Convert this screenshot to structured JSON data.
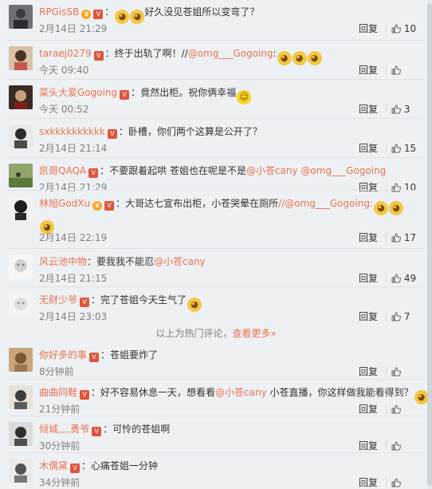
{
  "hot_comments": [
    {
      "user": "RPGisSB",
      "crown": true,
      "mentions": [],
      "text": "好久没见苍姐所以变弯了？",
      "lead_emoji": 2,
      "trail_emoji": 0,
      "time": "2月14日 21:29",
      "likes": "10"
    },
    {
      "user": "taraej0279",
      "crown": false,
      "text": "终于出轨了啊！//",
      "mention_text": "@omg___Gogoing",
      "after_text": ":",
      "trail_emoji": 3,
      "time": "今天 09:40",
      "likes": ""
    },
    {
      "user": "菜头大爱Gogoing",
      "crown": false,
      "text": "竟然出柜。祝你俩幸福",
      "trail_emoji": 1,
      "laugh": true,
      "time": "今天 00:52",
      "likes": "3"
    },
    {
      "user": "sxkkkkkkkkkk",
      "crown": false,
      "text": "卧槽，你们两个这算是公开了？",
      "trail_emoji": 0,
      "time": "2月14日 21:14",
      "likes": "15"
    },
    {
      "user": "凯哥QAQA",
      "crown": false,
      "text": "不要跟着起哄  苍姐也在呢是不是",
      "mention_text": "@小苍cany @omg___Gogoing",
      "after_text": "",
      "trail_emoji": 0,
      "time": "2月14日 21:29",
      "likes": "10"
    },
    {
      "user": "林旭GodXu",
      "crown": true,
      "text": "大哥达七宣布出柜，小苍哭晕在厕所",
      "mention_text": "//@omg___Gogoing:",
      "after_text": "",
      "trail_emoji": 3,
      "time": "2月14日 22:19",
      "likes": "17"
    },
    {
      "user": "风云池中物",
      "crown": false,
      "text": "要我我不能忍",
      "mention_text": "@小苍cany",
      "after_text": "",
      "trail_emoji": 0,
      "time": "2月14日 21:15",
      "likes": "49"
    },
    {
      "user": "无财少爷",
      "crown": false,
      "text": "完了苍姐今天生气了",
      "trail_emoji": 1,
      "time": "2月14日 23:03",
      "likes": "7"
    }
  ],
  "divider": {
    "text": "以上为热门评论，",
    "link": "查看更多",
    "arrow": "»"
  },
  "recent_comments": [
    {
      "user": "你好多的事",
      "text": "苍姐要炸了",
      "time": "8分钟前",
      "likes": ""
    },
    {
      "user": "曲曲同鞋",
      "text": "好不容易休息一天，想看看",
      "mention_text": "@小苍cany",
      "after_text": " 小苍直播，你这样做我能看得到？",
      "trail_emoji": 1,
      "time": "21分钟前",
      "likes": ""
    },
    {
      "user": "倾城,,,,勇爷",
      "text": "可怜的苍姐啊",
      "time": "30分钟前",
      "likes": ""
    },
    {
      "user": "木偶黛",
      "text": "心痛苍姐一分钟",
      "time": "34分钟前",
      "likes": ""
    }
  ],
  "labels": {
    "reply": "回复",
    "colon": "："
  },
  "colors": {
    "accent": "#eb7350",
    "background": "#eef1f4",
    "time": "#808080"
  }
}
